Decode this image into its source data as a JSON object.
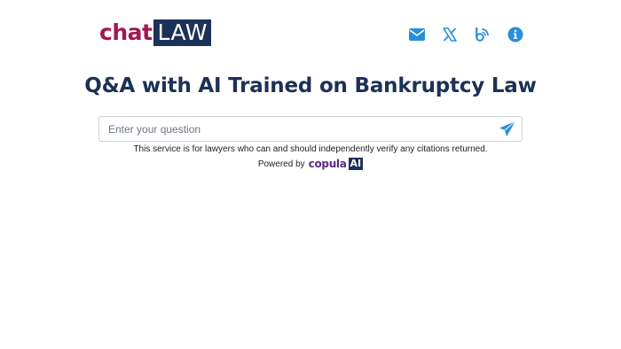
{
  "header": {
    "logo": {
      "part1": "chat",
      "part2": "LAW"
    },
    "nav_icons": [
      "mail-icon",
      "x-twitter-icon",
      "blog-icon",
      "info-icon"
    ]
  },
  "main": {
    "title": "Q&A with AI Trained on Bankruptcy Law",
    "search": {
      "placeholder": "Enter your question",
      "value": ""
    },
    "disclaimer": "This service is for lawyers who can and should independently verify any citations returned.",
    "powered_by": {
      "label": "Powered by",
      "brand": "copula",
      "brand_suffix": "AI"
    }
  },
  "colors": {
    "brand_red": "#a4164f",
    "navy": "#1c3157",
    "icon_blue": "#2a8fd8",
    "copula_purple": "#5b2a86"
  }
}
